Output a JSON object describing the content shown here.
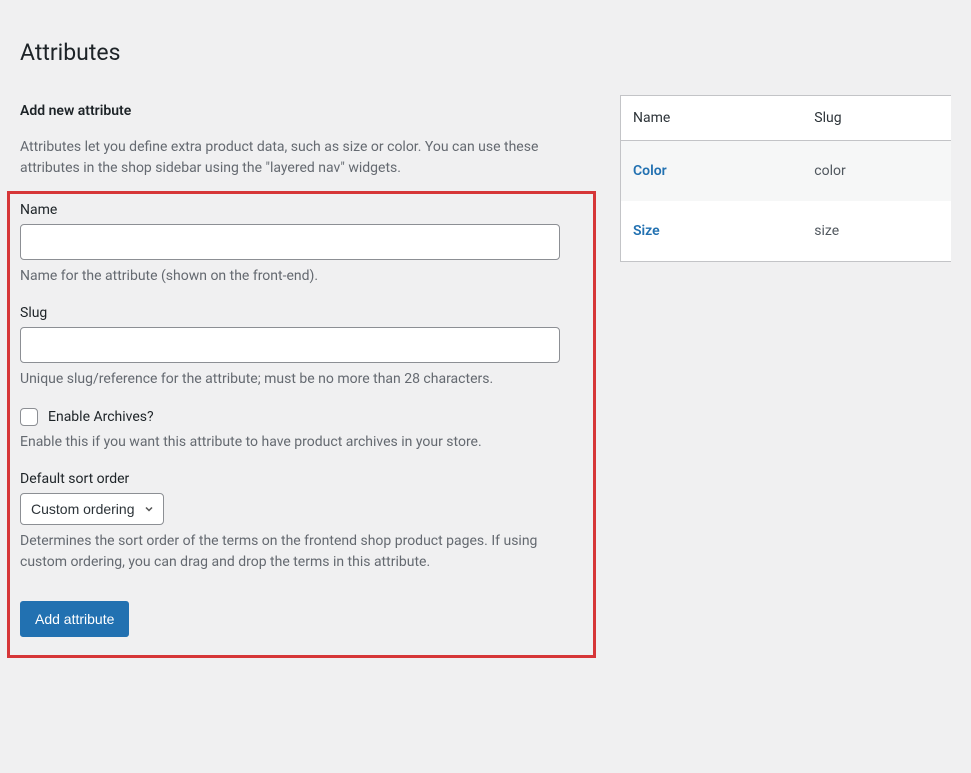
{
  "page": {
    "title": "Attributes"
  },
  "form": {
    "heading": "Add new attribute",
    "intro": "Attributes let you define extra product data, such as size or color. You can use these attributes in the shop sidebar using the \"layered nav\" widgets.",
    "name": {
      "label": "Name",
      "value": "",
      "description": "Name for the attribute (shown on the front-end)."
    },
    "slug": {
      "label": "Slug",
      "value": "",
      "description": "Unique slug/reference for the attribute; must be no more than 28 characters."
    },
    "archives": {
      "label": "Enable Archives?",
      "description": "Enable this if you want this attribute to have product archives in your store."
    },
    "sort": {
      "label": "Default sort order",
      "selected": "Custom ordering",
      "description": "Determines the sort order of the terms on the frontend shop product pages. If using custom ordering, you can drag and drop the terms in this attribute."
    },
    "submit_label": "Add attribute"
  },
  "table": {
    "columns": {
      "name": "Name",
      "slug": "Slug"
    },
    "rows": [
      {
        "name": "Color",
        "slug": "color"
      },
      {
        "name": "Size",
        "slug": "size"
      }
    ]
  }
}
